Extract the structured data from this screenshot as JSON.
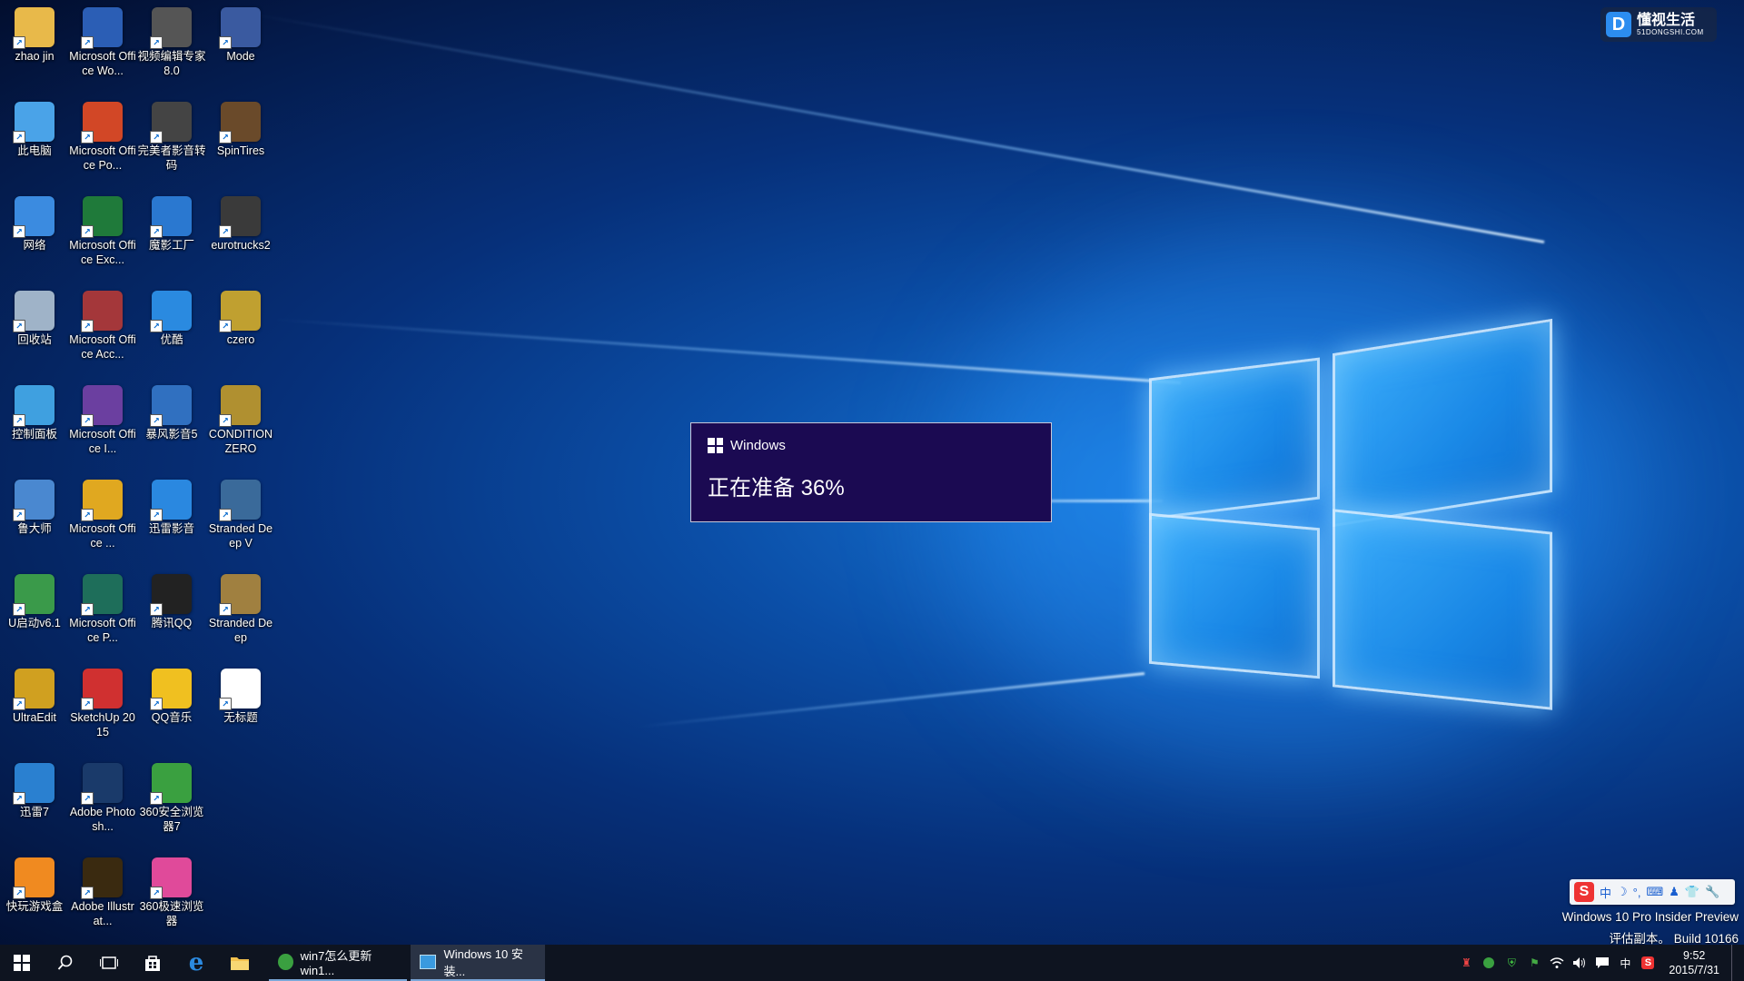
{
  "desktop": {
    "icons": [
      {
        "label": "zhao jin",
        "icon": "user-folder-icon",
        "color": "#e8b94a"
      },
      {
        "label": "此电脑",
        "icon": "computer-icon",
        "color": "#4aa3e8"
      },
      {
        "label": "网络",
        "icon": "network-icon",
        "color": "#3b8be0"
      },
      {
        "label": "回收站",
        "icon": "recycle-bin-icon",
        "color": "#9fb3c8"
      },
      {
        "label": "控制面板",
        "icon": "control-panel-icon",
        "color": "#3fa0e0"
      },
      {
        "label": "鲁大师",
        "icon": "ludashi-icon",
        "color": "#4a88d0"
      },
      {
        "label": "U启动v6.1",
        "icon": "uqidong-icon",
        "color": "#3a9a4a"
      },
      {
        "label": "UltraEdit",
        "icon": "ultraedit-icon",
        "color": "#d0a020"
      },
      {
        "label": "迅雷7",
        "icon": "xunlei-icon",
        "color": "#2a80d0"
      },
      {
        "label": "快玩游戏盒",
        "icon": "kuaiwan-icon",
        "color": "#f08a20"
      },
      {
        "label": "Microsoft Office Wo...",
        "icon": "word-icon",
        "color": "#2b5eb5"
      },
      {
        "label": "Microsoft Office Po...",
        "icon": "powerpoint-icon",
        "color": "#d24726"
      },
      {
        "label": "Microsoft Office Exc...",
        "icon": "excel-icon",
        "color": "#1f7a3a"
      },
      {
        "label": "Microsoft Office Acc...",
        "icon": "access-icon",
        "color": "#a4373a"
      },
      {
        "label": "Microsoft Office I...",
        "icon": "infopath-icon",
        "color": "#6b3fa0"
      },
      {
        "label": "Microsoft Office ...",
        "icon": "outlook-icon",
        "color": "#e0a820"
      },
      {
        "label": "Microsoft Office P...",
        "icon": "publisher-icon",
        "color": "#1e6e5a"
      },
      {
        "label": "SketchUp 2015",
        "icon": "sketchup-icon",
        "color": "#d03030"
      },
      {
        "label": "Adobe Photosh...",
        "icon": "photoshop-icon",
        "color": "#1a3a6a"
      },
      {
        "label": "Adobe Illustrat...",
        "icon": "illustrator-icon",
        "color": "#3a2a10"
      },
      {
        "label": "视频编辑专家 8.0",
        "icon": "video-editor-icon",
        "color": "#555555"
      },
      {
        "label": "完美者影音转码",
        "icon": "video-convert-icon",
        "color": "#444444"
      },
      {
        "label": "魔影工厂",
        "icon": "moying-icon",
        "color": "#2a78d0"
      },
      {
        "label": "优酷",
        "icon": "youku-icon",
        "color": "#2a8ae0"
      },
      {
        "label": "暴风影音5",
        "icon": "baofeng-icon",
        "color": "#3070c0"
      },
      {
        "label": "迅雷影音",
        "icon": "xunlei-player-icon",
        "color": "#2a88e0"
      },
      {
        "label": "腾讯QQ",
        "icon": "qq-icon",
        "color": "#222222"
      },
      {
        "label": "QQ音乐",
        "icon": "qq-music-icon",
        "color": "#f0c020"
      },
      {
        "label": "360安全浏览器7",
        "icon": "360-browser-icon",
        "color": "#3aa040"
      },
      {
        "label": "360极速浏览器",
        "icon": "360-speed-browser-icon",
        "color": "#e04a9a"
      },
      {
        "label": "Mode",
        "icon": "mode-icon",
        "color": "#3a5aa0"
      },
      {
        "label": "SpinTires",
        "icon": "spintires-icon",
        "color": "#6a4a2a"
      },
      {
        "label": "eurotrucks2",
        "icon": "eurotrucks-icon",
        "color": "#3a3a3a"
      },
      {
        "label": "czero",
        "icon": "czero-icon",
        "color": "#c0a030"
      },
      {
        "label": "CONDITION ZERO",
        "icon": "condition-zero-icon",
        "color": "#b09030"
      },
      {
        "label": "Stranded Deep V",
        "icon": "stranded-deep-v-icon",
        "color": "#3a6a9a"
      },
      {
        "label": "Stranded Deep",
        "icon": "stranded-deep-icon",
        "color": "#a08040"
      },
      {
        "label": "无标题",
        "icon": "untitled-icon",
        "color": "#ffffff"
      }
    ]
  },
  "watermark": {
    "title": "懂视生活",
    "subtitle": "51DONGSHI.COM",
    "logo_letter": "D"
  },
  "dialog": {
    "title": "Windows",
    "message": "正在准备 36%"
  },
  "ime": {
    "logo": "S",
    "glyphs": [
      "中",
      "☽",
      "°,",
      "⌨",
      "♟",
      "👕",
      "🔧"
    ]
  },
  "build_info": {
    "line1": "Windows 10 Pro Insider Preview",
    "line2": "评估副本。 Build 10166"
  },
  "taskbar": {
    "tasks": [
      {
        "label": "win7怎么更新win1...",
        "icon": "360-browser-icon",
        "active": false
      },
      {
        "label": "Windows 10 安装...",
        "icon": "windows-setup-icon",
        "active": true
      }
    ],
    "tray_ime": "中",
    "clock_time": "9:52",
    "clock_date": "2015/7/31"
  }
}
